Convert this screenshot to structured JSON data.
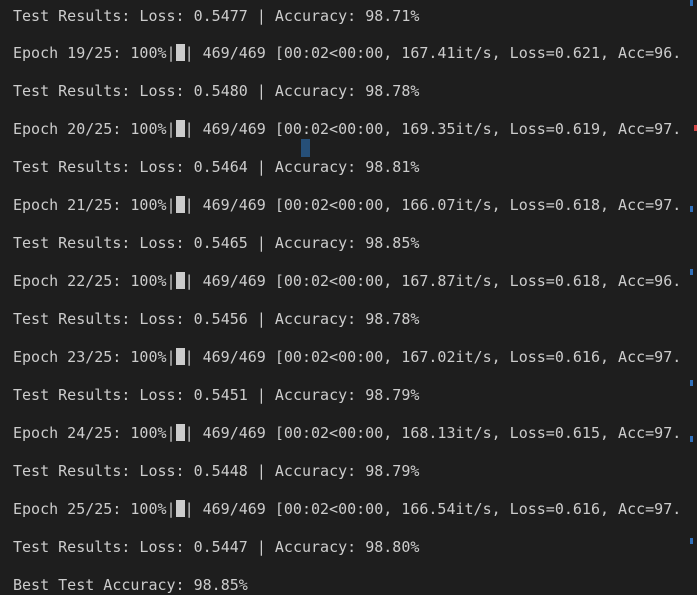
{
  "lines": [
    {
      "type": "test",
      "text": "Test Results: Loss: 0.5477 | Accuracy: 98.71%"
    },
    {
      "type": "epoch",
      "pre": "Epoch 19/25: 100%|",
      "post": "| 469/469 [00:02<00:00, 167.41it/s, Loss=0.621, Acc=96."
    },
    {
      "type": "test",
      "text": "Test Results: Loss: 0.5480 | Accuracy: 98.78%"
    },
    {
      "type": "epoch",
      "pre": "Epoch 20/25: 100%|",
      "post": "| 469/469 [00:02<00:00, 169.35it/s, Loss=0.619, Acc=97."
    },
    {
      "type": "test",
      "text": "Test Results: Loss: 0.5464 | Accuracy: 98.81%"
    },
    {
      "type": "epoch",
      "pre": "Epoch 21/25: 100%|",
      "post": "| 469/469 [00:02<00:00, 166.07it/s, Loss=0.618, Acc=97."
    },
    {
      "type": "test",
      "text": "Test Results: Loss: 0.5465 | Accuracy: 98.85%"
    },
    {
      "type": "epoch",
      "pre": "Epoch 22/25: 100%|",
      "post": "| 469/469 [00:02<00:00, 167.87it/s, Loss=0.618, Acc=96."
    },
    {
      "type": "test",
      "text": "Test Results: Loss: 0.5456 | Accuracy: 98.78%"
    },
    {
      "type": "epoch",
      "pre": "Epoch 23/25: 100%|",
      "post": "| 469/469 [00:02<00:00, 167.02it/s, Loss=0.616, Acc=97."
    },
    {
      "type": "test",
      "text": "Test Results: Loss: 0.5451 | Accuracy: 98.79%"
    },
    {
      "type": "epoch",
      "pre": "Epoch 24/25: 100%|",
      "post": "| 469/469 [00:02<00:00, 168.13it/s, Loss=0.615, Acc=97."
    },
    {
      "type": "test",
      "text": "Test Results: Loss: 0.5448 | Accuracy: 98.79%"
    },
    {
      "type": "epoch",
      "pre": "Epoch 25/25: 100%|",
      "post": "| 469/469 [00:02<00:00, 166.54it/s, Loss=0.616, Acc=97."
    },
    {
      "type": "test",
      "text": "Test Results: Loss: 0.5447 | Accuracy: 98.80%"
    },
    {
      "type": "test",
      "text": "Best Test Accuracy: 98.85%"
    }
  ],
  "colors": {
    "background": "#1e1e1e",
    "text": "#cccccc",
    "cursor": "#264f78",
    "scroll_mark": "#3794ff",
    "error_mark": "#f14c4c"
  }
}
